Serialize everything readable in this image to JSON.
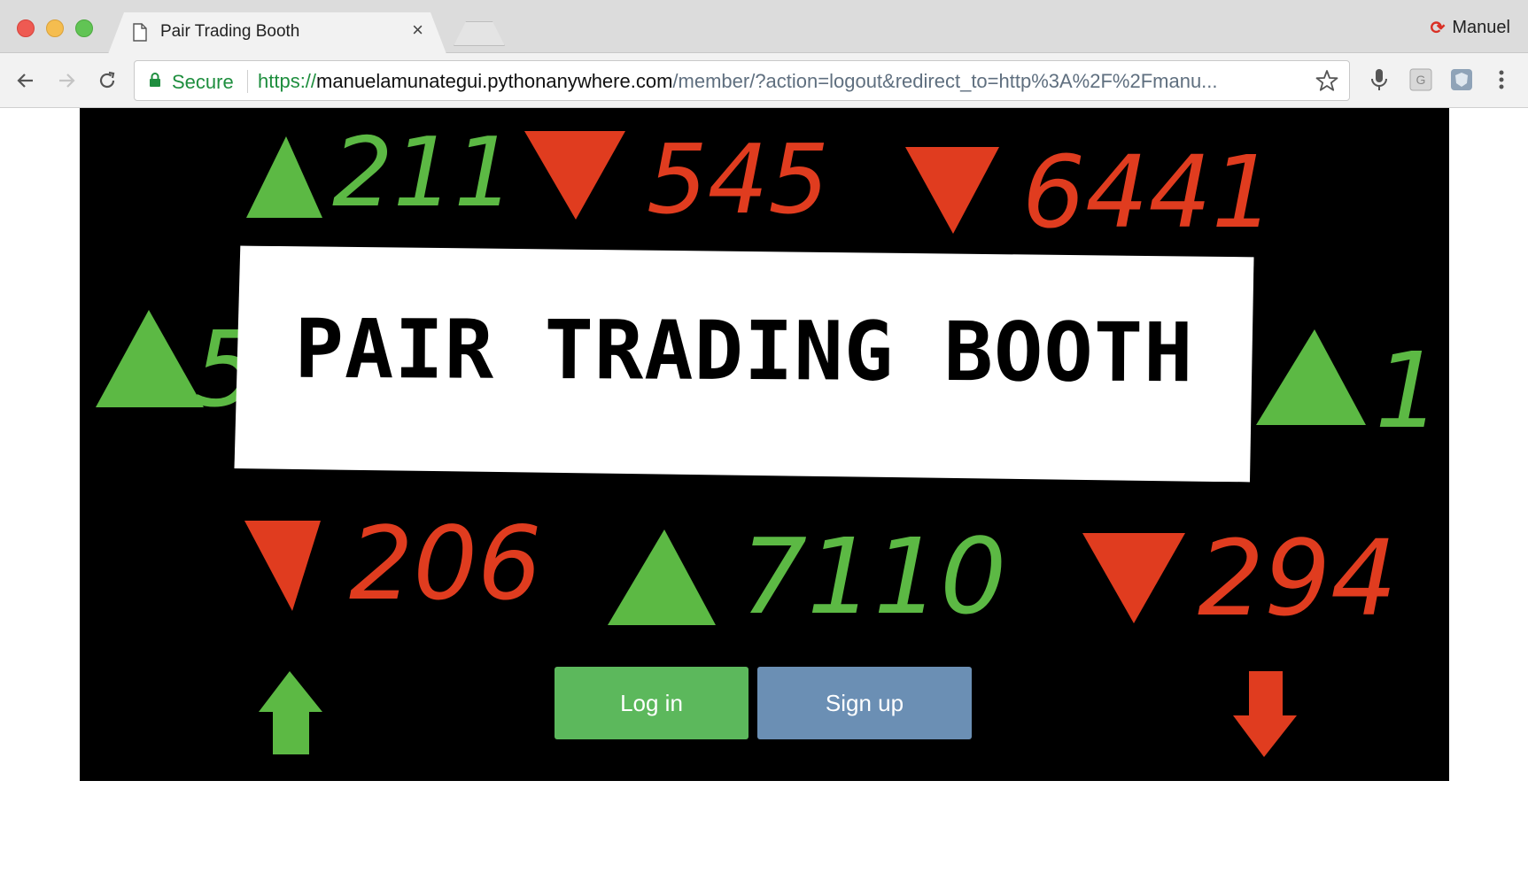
{
  "browser": {
    "tab_title": "Pair Trading Booth",
    "profile_name": "Manuel",
    "secure_label": "Secure",
    "url_scheme": "https://",
    "url_host": "manuelamunategui.pythonanywhere.com",
    "url_path": "/member/?action=logout&redirect_to=http%3A%2F%2Fmanu..."
  },
  "page": {
    "title": "PAIR TRADING BOOTH",
    "ticker_top": [
      {
        "dir": "up",
        "value": "211"
      },
      {
        "dir": "down",
        "value": "545"
      },
      {
        "dir": "down",
        "value": "6441"
      }
    ],
    "ticker_middle": [
      {
        "dir": "up",
        "value": "5"
      },
      {
        "dir": "up",
        "value": "1"
      }
    ],
    "ticker_bottom": [
      {
        "dir": "down",
        "value": "206"
      },
      {
        "dir": "up",
        "value": "7110"
      },
      {
        "dir": "down",
        "value": "294"
      }
    ],
    "login_label": "Log in",
    "signup_label": "Sign up"
  },
  "colors": {
    "up": "#5cb944",
    "down": "#e03c1f",
    "login_button": "#5cb85c",
    "signup_button": "#6b8fb4"
  },
  "icons": [
    "document-icon",
    "close-icon",
    "lock-icon",
    "star-icon",
    "microphone-icon",
    "back-arrow-icon",
    "forward-arrow-icon",
    "reload-icon",
    "menu-icon",
    "up-arrow-icon",
    "down-arrow-icon"
  ]
}
